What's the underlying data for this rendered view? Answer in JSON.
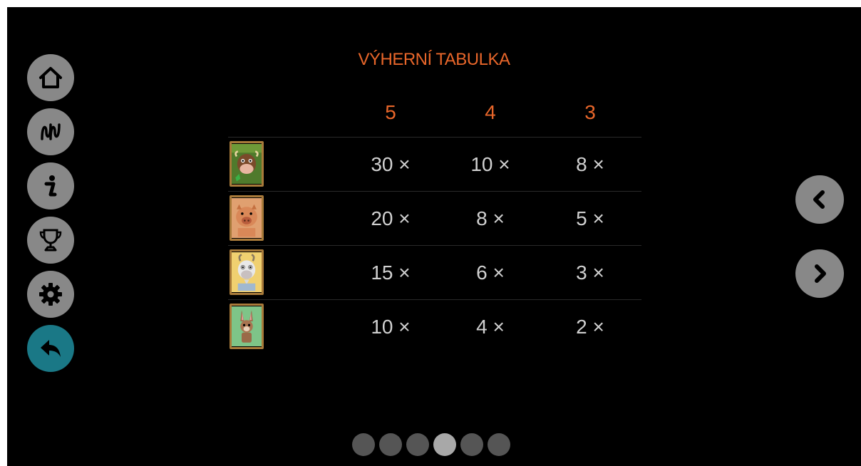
{
  "title": "VÝHERNÍ TABULKA",
  "colors": {
    "accent": "#e8662a",
    "button": "#888888",
    "active_button": "#1a7886",
    "background": "#000000"
  },
  "sidebar": {
    "buttons": [
      {
        "icon": "home-icon"
      },
      {
        "icon": "paylines-icon"
      },
      {
        "icon": "info-icon"
      },
      {
        "icon": "trophy-icon"
      },
      {
        "icon": "gear-icon"
      },
      {
        "icon": "back-icon",
        "active": true
      }
    ]
  },
  "paytable": {
    "headers": [
      "5",
      "4",
      "3"
    ],
    "rows": [
      {
        "symbol": "cow-symbol",
        "values": [
          "30 ×",
          "10 ×",
          "8 ×"
        ]
      },
      {
        "symbol": "pig-symbol",
        "values": [
          "20 ×",
          "8 ×",
          "5 ×"
        ]
      },
      {
        "symbol": "goat-symbol",
        "values": [
          "15 ×",
          "6 ×",
          "3 ×"
        ]
      },
      {
        "symbol": "rabbit-symbol",
        "values": [
          "10 ×",
          "4 ×",
          "2 ×"
        ]
      }
    ]
  },
  "pagination": {
    "total": 6,
    "current": 4
  }
}
